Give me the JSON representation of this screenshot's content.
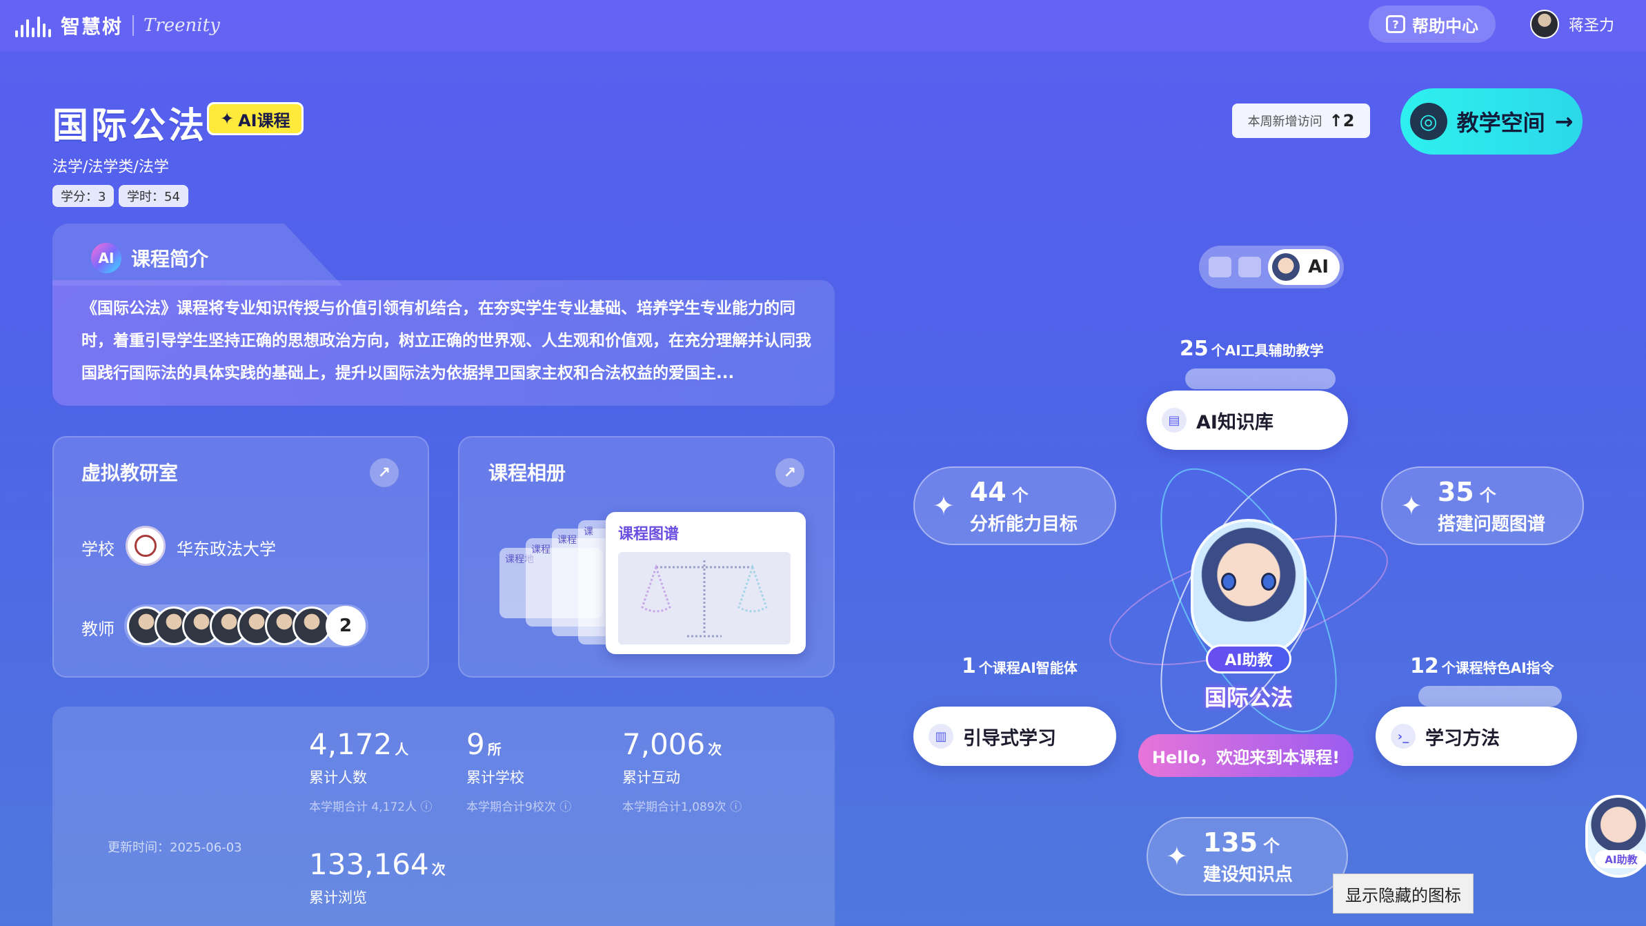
{
  "topbar": {
    "logo_cn": "智慧树",
    "logo_en": "Treenity",
    "help_label": "帮助中心",
    "user_name": "蒋圣力"
  },
  "course": {
    "title": "国际公法",
    "ai_badge": "AI课程",
    "category": "法学/法学类/法学",
    "credits": "学分：3",
    "hours": "学时：54"
  },
  "visits": {
    "label": "本周新增访问",
    "value": "2"
  },
  "space_button": "教学空间",
  "intro": {
    "heading": "课程简介",
    "ai_logo": "AI",
    "text": "《国际公法》课程将专业知识传授与价值引领有机结合，在夯实学生专业基础、培养学生专业能力的同时，着重引导学生坚持正确的思想政治方向，树立正确的世界观、人生观和价值观，在充分理解并认同我国践行国际法的具体实践的基础上，提升以国际法为依据捍卫国家主权和合法权益的爱国主..."
  },
  "lab": {
    "title": "虚拟教研室",
    "school_label": "学校",
    "school_name": "华东政法大学",
    "teacher_label": "教师",
    "teacher_more": "2"
  },
  "album": {
    "title": "课程相册",
    "main_sheet": "课程图谱",
    "mini_sheets": [
      "课程地",
      "课程",
      "课程",
      "课"
    ]
  },
  "stats": {
    "update_time": "更新时间：2025-06-03",
    "items": [
      {
        "value": "4,172",
        "unit": "人",
        "label": "累计人数",
        "sub": "本学期合计 4,172人"
      },
      {
        "value": "9",
        "unit": "所",
        "label": "累计学校",
        "sub": "本学期合计9校次"
      },
      {
        "value": "7,006",
        "unit": "次",
        "label": "累计互动",
        "sub": "本学期合计1,089次"
      },
      {
        "value": "133,164",
        "unit": "次",
        "label": "累计浏览"
      }
    ]
  },
  "ai_panel": {
    "tool_pill_ai": "AI",
    "tools_count": "25",
    "tools_caption": "个AI工具辅助教学",
    "knowledge_base": "AI知识库",
    "goals_num": "44",
    "goals_unit": "个",
    "goals_label": "分析能力目标",
    "problems_num": "35",
    "problems_unit": "个",
    "problems_label": "搭建问题图谱",
    "agents_count": "1",
    "agents_caption": "个课程AI智能体",
    "guided_learning": "引导式学习",
    "commands_count": "12",
    "commands_caption": "个课程特色AI指令",
    "study_method": "学习方法",
    "helper_tag": "AI助教",
    "hub_title": "国际公法",
    "hello": "Hello，欢迎来到本课程!",
    "points_num": "135",
    "points_unit": "个",
    "points_label": "建设知识点"
  },
  "float_helper": "AI助教",
  "tooltip": "显示隐藏的图标"
}
